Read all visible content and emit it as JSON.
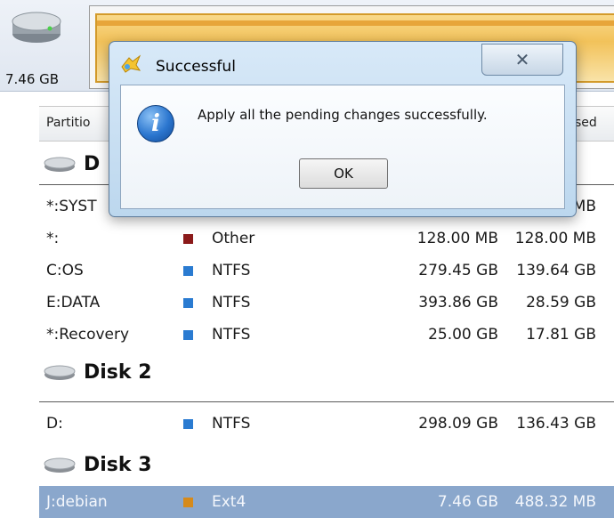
{
  "top_disk": {
    "size": "7.46 GB"
  },
  "columns": {
    "partition": "Partitio",
    "used": "sed"
  },
  "disk1": {
    "name": "D",
    "rows": [
      {
        "name": "*:SYST",
        "type": "",
        "capacity": "",
        "used": "MB",
        "color": "#2fae5e"
      },
      {
        "name": "*:",
        "type": "Other",
        "capacity": "128.00 MB",
        "used": "128.00 MB",
        "color": "#8b1a1a"
      },
      {
        "name": "C:OS",
        "type": "NTFS",
        "capacity": "279.45 GB",
        "used": "139.64 GB",
        "color": "#2a7bd1"
      },
      {
        "name": "E:DATA",
        "type": "NTFS",
        "capacity": "393.86 GB",
        "used": "28.59 GB",
        "color": "#2a7bd1"
      },
      {
        "name": "*:Recovery",
        "type": "NTFS",
        "capacity": "25.00 GB",
        "used": "17.81 GB",
        "color": "#2a7bd1"
      }
    ]
  },
  "disk2": {
    "name": "Disk 2",
    "rows": [
      {
        "name": "D:",
        "type": "NTFS",
        "capacity": "298.09 GB",
        "used": "136.43 GB",
        "color": "#2a7bd1"
      }
    ]
  },
  "disk3": {
    "name": "Disk 3",
    "rows": [
      {
        "name": "J:debian",
        "type": "Ext4",
        "capacity": "7.46 GB",
        "used": "488.32 MB",
        "color": "#d68a1a"
      }
    ]
  },
  "dialog": {
    "title": "Successful",
    "close_glyph": "✕",
    "message": "Apply all the pending changes successfully.",
    "ok_label": "OK",
    "info_glyph": "i"
  }
}
